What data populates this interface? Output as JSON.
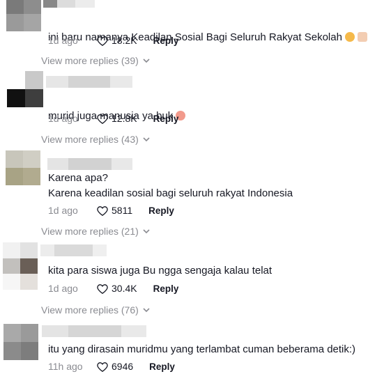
{
  "comments": [
    {
      "text": "ini baru namanya Keadilan Sosial Bagi Seluruh Rakyat Sekolah",
      "emojis": [
        "grinning-face-emoji",
        "thumbs-up-emoji"
      ],
      "time": "1d ago",
      "likes": "18.2K",
      "reply": "Reply",
      "more": "View more replies (39)"
    },
    {
      "text": "murid juga manusia ya buk",
      "emojis": [
        "smiling-face-with-hearts-emoji"
      ],
      "time": "1d ago",
      "likes": "12.8K",
      "reply": "Reply",
      "more": "View more replies (43)"
    },
    {
      "text": "Karena apa?\nKarena keadilan sosial bagi seluruh rakyat Indonesia",
      "emojis": [],
      "time": "1d ago",
      "likes": "5811",
      "reply": "Reply",
      "more": "View more replies (21)"
    },
    {
      "text": "kita para siswa juga Bu ngga sengaja kalau telat",
      "emojis": [],
      "time": "1d ago",
      "likes": "30.4K",
      "reply": "Reply",
      "more": "View more replies (76)"
    },
    {
      "text": "itu yang dirasain muridmu yang terlambat cuman beberama detik:)",
      "emojis": [],
      "time": "11h ago",
      "likes": "6946",
      "reply": "Reply",
      "more": ""
    }
  ],
  "colors": {
    "text": "#161823",
    "secondary": "#8a8b91",
    "heart_icon": "#161823"
  },
  "icons": {
    "like": "heart-outline-icon",
    "expand": "chevron-down-icon"
  }
}
